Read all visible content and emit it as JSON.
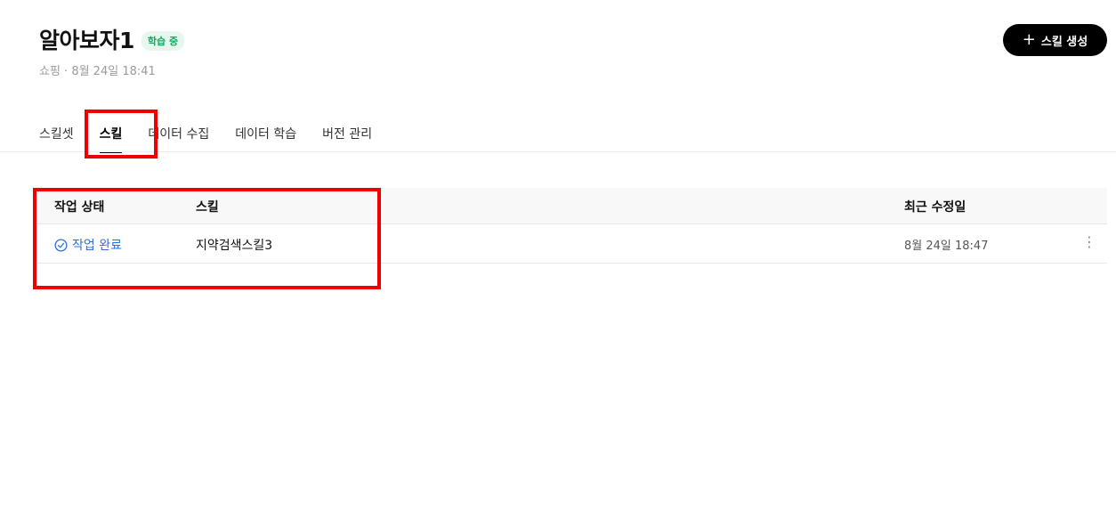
{
  "header": {
    "title": "알아보자1",
    "badge": "학습 중",
    "meta": "쇼핑 · 8월 24일 18:41",
    "create_button_label": "스킬 생성",
    "create_button_icon": "+"
  },
  "tabs": [
    {
      "label": "스킬셋",
      "active": false
    },
    {
      "label": "스킬",
      "active": true
    },
    {
      "label": "데이터 수집",
      "active": false
    },
    {
      "label": "데이터 학습",
      "active": false
    },
    {
      "label": "버전 관리",
      "active": false
    }
  ],
  "table": {
    "columns": [
      "작업 상태",
      "스킬",
      "최근 수정일"
    ],
    "rows": [
      {
        "status": "작업 완료",
        "skill": "지약검색스킬3",
        "modified": "8월 24일 18:47",
        "more_icon": "⋮"
      }
    ]
  },
  "colors": {
    "accent": "#2f6fe0",
    "badge_text": "#19a862",
    "badge_bg": "#e6f7ee",
    "highlight": "#ee0000"
  }
}
